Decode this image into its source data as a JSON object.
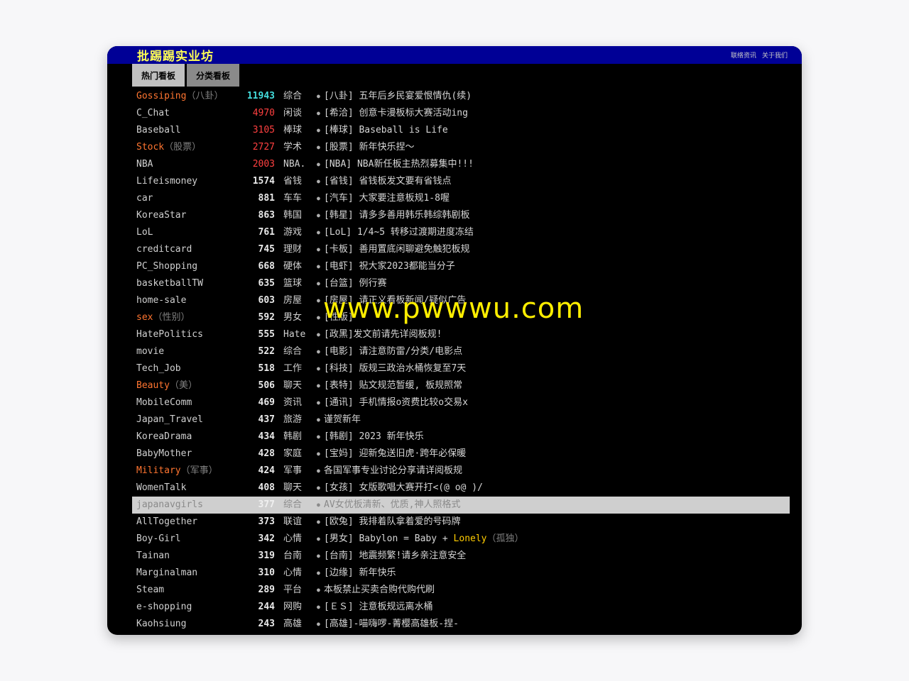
{
  "header": {
    "title": "批踢踢实业坊",
    "links": [
      "联络资讯",
      "关于我们"
    ]
  },
  "tabs": [
    {
      "label": "热门看板",
      "active": true
    },
    {
      "label": "分类看板",
      "active": false
    }
  ],
  "boards": [
    {
      "name": "Gossiping",
      "name_suffix": "（八卦）",
      "highlight": true,
      "count": "11943",
      "count_color": "cyan",
      "category": "综合",
      "title": "[八卦] 五年后乡民宴爱恨情仇(续)"
    },
    {
      "name": "C_Chat",
      "name_suffix": "",
      "highlight": false,
      "count": "4970",
      "count_color": "red",
      "category": "闲谈",
      "title": "[希洽] 创意卡漫板标大赛活动ing"
    },
    {
      "name": "Baseball",
      "name_suffix": "",
      "highlight": false,
      "count": "3105",
      "count_color": "red",
      "category": "棒球",
      "title": "[棒球] Baseball is Life"
    },
    {
      "name": "Stock",
      "name_suffix": "（股票）",
      "highlight": true,
      "count": "2727",
      "count_color": "red",
      "category": "学术",
      "title": "[股票] 新年快乐捏～"
    },
    {
      "name": "NBA",
      "name_suffix": "",
      "highlight": false,
      "count": "2003",
      "count_color": "red",
      "category": "NBA.",
      "title": "[NBA] NBA新任板主热烈募集中!!!"
    },
    {
      "name": "Lifeismoney",
      "name_suffix": "",
      "highlight": false,
      "count": "1574",
      "count_color": "white",
      "category": "省钱",
      "title": "[省钱] 省钱板发文要有省钱点"
    },
    {
      "name": "car",
      "name_suffix": "",
      "highlight": false,
      "count": "881",
      "count_color": "white",
      "category": "车车",
      "title": "[汽车] 大家要注意板规1-8喔"
    },
    {
      "name": "KoreaStar",
      "name_suffix": "",
      "highlight": false,
      "count": "863",
      "count_color": "white",
      "category": "韩国",
      "title": "[韩星] 请多多善用韩乐韩综韩剧板"
    },
    {
      "name": "LoL",
      "name_suffix": "",
      "highlight": false,
      "count": "761",
      "count_color": "white",
      "category": "游戏",
      "title": "[LoL] 1/4~5 转移过渡期进度冻结"
    },
    {
      "name": "creditcard",
      "name_suffix": "",
      "highlight": false,
      "count": "745",
      "count_color": "white",
      "category": "理财",
      "title": "[卡板] 善用置底闲聊避免触犯板规"
    },
    {
      "name": "PC_Shopping",
      "name_suffix": "",
      "highlight": false,
      "count": "668",
      "count_color": "white",
      "category": "硬体",
      "title": "[电虾] 祝大家2023都能当分子"
    },
    {
      "name": "basketballTW",
      "name_suffix": "",
      "highlight": false,
      "count": "635",
      "count_color": "white",
      "category": "篮球",
      "title": "[台篮] 例行赛"
    },
    {
      "name": "home-sale",
      "name_suffix": "",
      "highlight": false,
      "count": "603",
      "count_color": "white",
      "category": "房屋",
      "title": "[房屋] 请正义看板新闻/疑似广告"
    },
    {
      "name": "sex",
      "name_suffix": "（性别）",
      "highlight": true,
      "count": "592",
      "count_color": "white",
      "category": "男女",
      "title": "[性版]"
    },
    {
      "name": "HatePolitics",
      "name_suffix": "",
      "highlight": false,
      "count": "555",
      "count_color": "white",
      "category": "Hate",
      "title": "[政黑]发文前请先详阅板规!"
    },
    {
      "name": "movie",
      "name_suffix": "",
      "highlight": false,
      "count": "522",
      "count_color": "white",
      "category": "综合",
      "title": "[电影] 请注意防雷/分类/电影点"
    },
    {
      "name": "Tech_Job",
      "name_suffix": "",
      "highlight": false,
      "count": "518",
      "count_color": "white",
      "category": "工作",
      "title": "[科技] 版规三政治水桶恢复至7天"
    },
    {
      "name": "Beauty",
      "name_suffix": "（美）",
      "highlight": true,
      "count": "506",
      "count_color": "white",
      "category": "聊天",
      "title": "[表特] 贴文规范暂缓, 板规照常"
    },
    {
      "name": "MobileComm",
      "name_suffix": "",
      "highlight": false,
      "count": "469",
      "count_color": "white",
      "category": "资讯",
      "title": "[通讯] 手机情报o资费比较o交易x"
    },
    {
      "name": "Japan_Travel",
      "name_suffix": "",
      "highlight": false,
      "count": "437",
      "count_color": "white",
      "category": "旅游",
      "title": "谨贺新年"
    },
    {
      "name": "KoreaDrama",
      "name_suffix": "",
      "highlight": false,
      "count": "434",
      "count_color": "white",
      "category": "韩剧",
      "title": "[韩剧] 2023 新年快乐"
    },
    {
      "name": "BabyMother",
      "name_suffix": "",
      "highlight": false,
      "count": "428",
      "count_color": "white",
      "category": "家庭",
      "title": "[宝妈] 迎新兔送旧虎·跨年必保暖"
    },
    {
      "name": "Military",
      "name_suffix": "（军事）",
      "highlight": true,
      "count": "424",
      "count_color": "white",
      "category": "军事",
      "title": "各国军事专业讨论分享请详阅板规"
    },
    {
      "name": "WomenTalk",
      "name_suffix": "",
      "highlight": false,
      "count": "408",
      "count_color": "white",
      "category": "聊天",
      "title": "[女孩] 女版歌唱大赛开打<(@ o@ )/"
    },
    {
      "name": "japanavgirls",
      "name_suffix": "",
      "highlight": false,
      "count": "377",
      "count_color": "white",
      "category": "综合",
      "title": "AV女优板清新、优质,神人照格式",
      "selected": true
    },
    {
      "name": "AllTogether",
      "name_suffix": "",
      "highlight": false,
      "count": "373",
      "count_color": "white",
      "category": "联谊",
      "title": "[欧兔] 我排着队拿着爱的号码牌"
    },
    {
      "name": "Boy-Girl",
      "name_suffix": "",
      "highlight": false,
      "count": "342",
      "count_color": "white",
      "category": "心情",
      "title": "[男女] Babylon = Baby + ",
      "title_hl": "Lonely",
      "title_suffix": "（孤独）"
    },
    {
      "name": "Tainan",
      "name_suffix": "",
      "highlight": false,
      "count": "319",
      "count_color": "white",
      "category": "台南",
      "title": "[台南] 地震频繁!请乡亲注意安全"
    },
    {
      "name": "Marginalman",
      "name_suffix": "",
      "highlight": false,
      "count": "310",
      "count_color": "white",
      "category": "心情",
      "title": "[边缘] 新年快乐"
    },
    {
      "name": "Steam",
      "name_suffix": "",
      "highlight": false,
      "count": "289",
      "count_color": "white",
      "category": "平台",
      "title": "本板禁止买卖合购代购代刷"
    },
    {
      "name": "e-shopping",
      "name_suffix": "",
      "highlight": false,
      "count": "244",
      "count_color": "white",
      "category": "网购",
      "title": "[ＥＳ] 注意板规远离水桶"
    },
    {
      "name": "Kaohsiung",
      "name_suffix": "",
      "highlight": false,
      "count": "243",
      "count_color": "white",
      "category": "高雄",
      "title": "[高雄]-喵嗨啰-菁樱高雄板-捏-"
    }
  ],
  "watermark": "www.pwwwu.com"
}
